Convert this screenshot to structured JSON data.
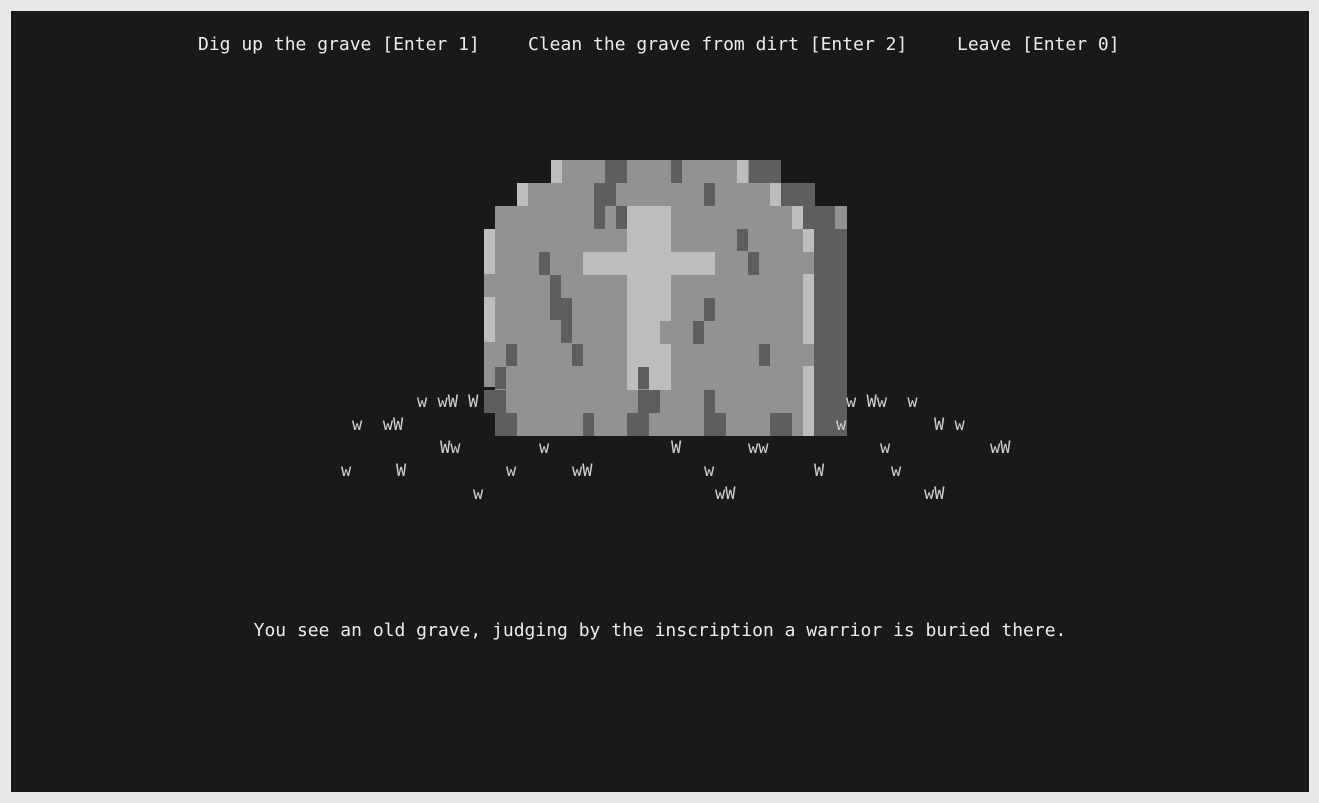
{
  "menu": {
    "dig": "Dig up the grave [Enter 1]",
    "clean": "Clean the grave from dirt [Enter 2]",
    "leave": "Leave [Enter 0]"
  },
  "message": "You see an old grave, judging by the inscription a warrior is buried there.",
  "grass": [
    "w wW W",
    "w Ww  w",
    "w  wW",
    "w",
    "W w",
    "Ww",
    "w",
    "W",
    "ww",
    "w",
    "wW",
    "w",
    "W",
    "w",
    "wW",
    "w",
    "W",
    "w",
    "w",
    "wW",
    "wW"
  ],
  "colors": {
    "background": "#191919",
    "text": "#ececec",
    "stone": "#929292",
    "stone_light": "#bdbdbd",
    "stone_dark": "#5e5e5e",
    "grass": "#cfcfcf"
  }
}
